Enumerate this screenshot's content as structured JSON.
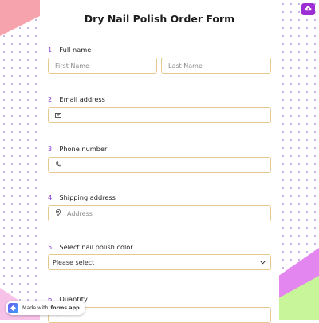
{
  "form": {
    "title": "Dry Nail Polish Order Form",
    "questions": [
      {
        "number": "1.",
        "label": "Full name",
        "fields": [
          {
            "placeholder": "First Name"
          },
          {
            "placeholder": "Last Name"
          }
        ]
      },
      {
        "number": "2.",
        "label": "Email address",
        "icon": "envelope-icon",
        "placeholder": ""
      },
      {
        "number": "3.",
        "label": "Phone number",
        "icon": "phone-icon",
        "placeholder": ""
      },
      {
        "number": "4.",
        "label": "Shipping address",
        "icon": "location-pin-icon",
        "placeholder": "Address"
      },
      {
        "number": "5.",
        "label": "Select nail polish color",
        "selected": "Please select"
      },
      {
        "number": "6.",
        "label": "Quantity",
        "value": "1"
      }
    ]
  },
  "top_button": {
    "icon": "cloud-upload-icon"
  },
  "badge": {
    "prefix": "Made with",
    "brand": "forms.app"
  },
  "colors": {
    "accent": "#8a3fd1",
    "field_border": "#e7c98f",
    "pink": "#f7a3ad",
    "violet": "#e486f0",
    "lime": "#c8f59a"
  }
}
